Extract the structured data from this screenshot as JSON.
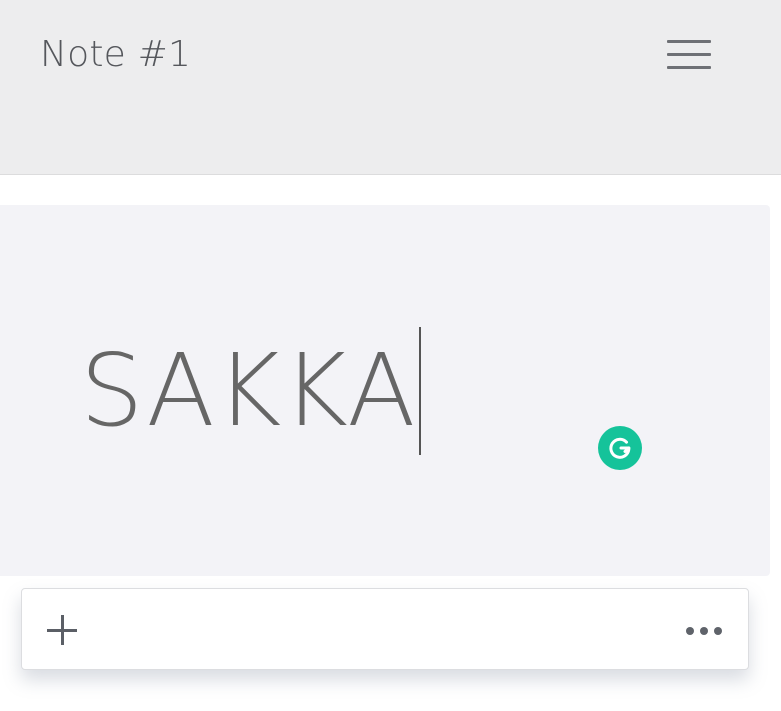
{
  "header": {
    "title": "Note #1",
    "menu_icon": "hamburger-menu-icon"
  },
  "editor": {
    "content": "SAKKA",
    "grammarly_icon": "grammarly-icon",
    "grammarly_color": "#15c39a"
  },
  "toolbar": {
    "add_icon": "plus-icon",
    "more_icon": "ellipsis-icon"
  },
  "colors": {
    "header_bg": "#ededee",
    "editor_bg": "#f3f3f7",
    "text": "#666666"
  }
}
